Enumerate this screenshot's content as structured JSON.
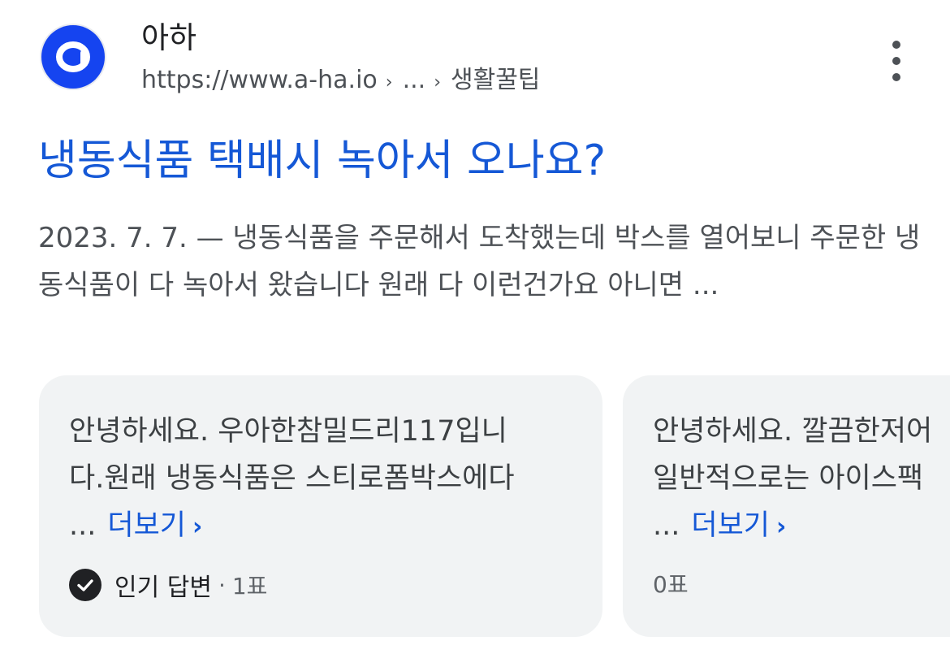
{
  "result": {
    "site_name": "아하",
    "url": "https://www.a-ha.io",
    "crumb_ellipsis": "...",
    "crumb_last": "생활꿀팁",
    "title": "냉동식품 택배시 녹아서 오나요?",
    "snippet_date": "2023. 7. 7. —",
    "snippet_text": "냉동식품을 주문해서 도착했는데 박스를 열어보니 주문한 냉동식품이 다 녹아서 왔습니다 원래 다 이런건가요 아니면 ..."
  },
  "answers": [
    {
      "line1": "안녕하세요. 우아한참밀드리117입니",
      "line2": "다.원래 냉동식품은 스티로폼박스에다",
      "ellipsis": "...",
      "more_label": "더보기",
      "badge": "인기 답변",
      "votes": "1표"
    },
    {
      "line1": "안녕하세요. 깔끔한저어",
      "line2": "일반적으로는 아이스팩",
      "ellipsis": "...",
      "more_label": "더보기",
      "votes": "0표"
    }
  ],
  "colors": {
    "link": "#1558d6",
    "logo_bg": "#1544f0",
    "card_bg": "#f1f3f4"
  }
}
